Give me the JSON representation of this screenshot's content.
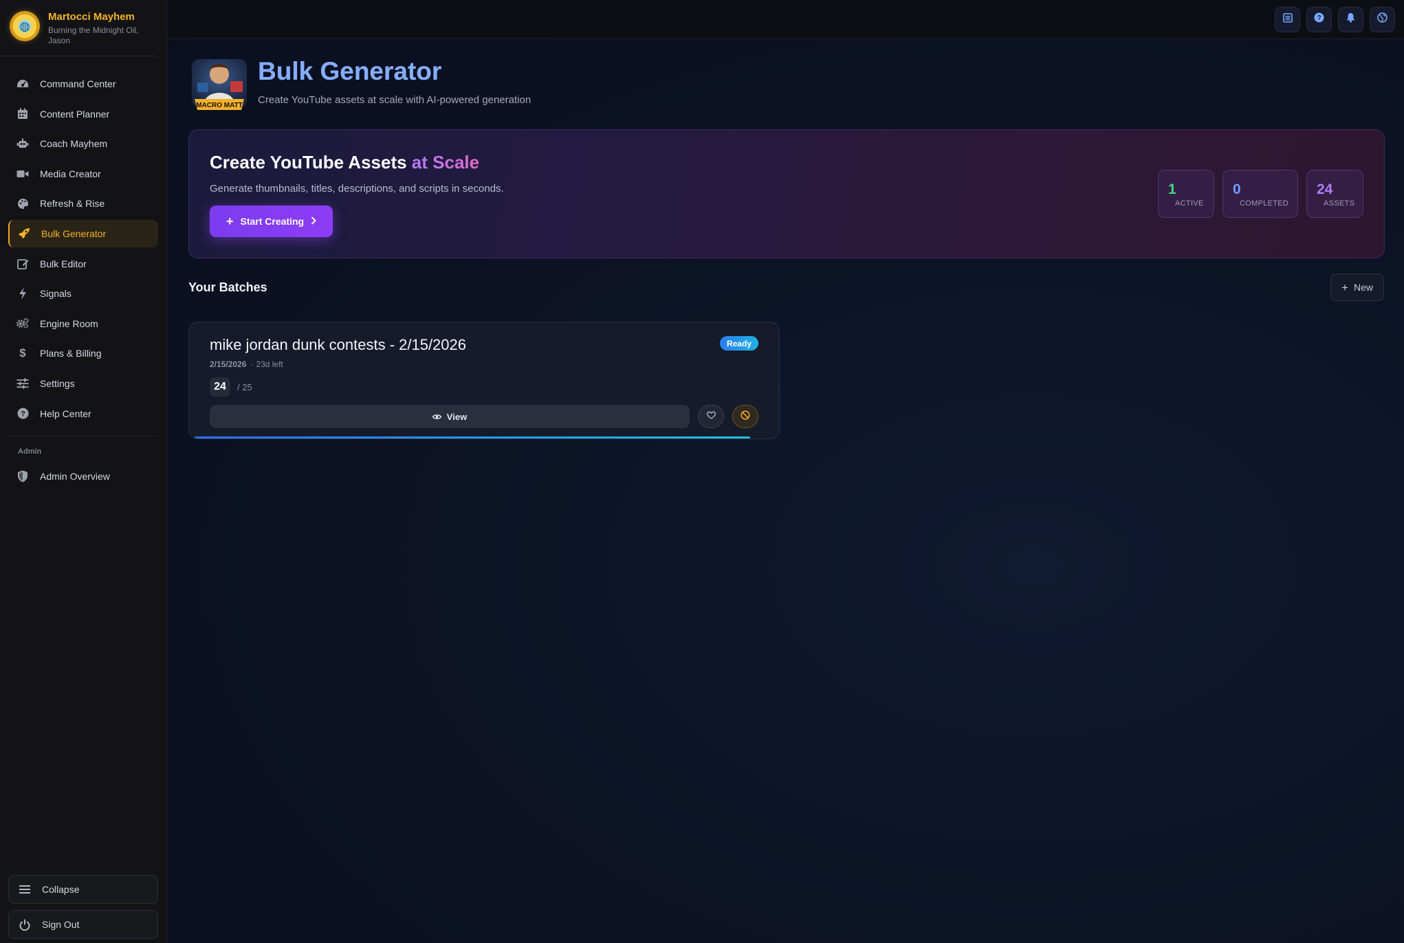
{
  "brand": {
    "name": "Martocci Mayhem",
    "subtitle": "Burning the Midnight Oil, Jason"
  },
  "sidebar": {
    "items": [
      {
        "label": "Command Center",
        "icon": "gauge-icon"
      },
      {
        "label": "Content Planner",
        "icon": "calendar-icon"
      },
      {
        "label": "Coach Mayhem",
        "icon": "robot-icon"
      },
      {
        "label": "Media Creator",
        "icon": "video-icon"
      },
      {
        "label": "Refresh & Rise",
        "icon": "palette-icon"
      },
      {
        "label": "Bulk Generator",
        "icon": "rocket-icon",
        "active": true
      },
      {
        "label": "Bulk Editor",
        "icon": "edit-icon"
      },
      {
        "label": "Signals",
        "icon": "bolt-icon"
      },
      {
        "label": "Engine Room",
        "icon": "gears-icon"
      },
      {
        "label": "Plans & Billing",
        "icon": "dollar-icon"
      },
      {
        "label": "Settings",
        "icon": "sliders-icon"
      },
      {
        "label": "Help Center",
        "icon": "question-icon"
      }
    ],
    "admin_label": "Admin",
    "admin_items": [
      {
        "label": "Admin Overview",
        "icon": "shield-icon"
      }
    ],
    "collapse_label": "Collapse",
    "signout_label": "Sign Out"
  },
  "topbar": {
    "buttons": [
      "list-icon",
      "help-icon",
      "bell-icon",
      "globe-icon"
    ]
  },
  "page": {
    "title": "Bulk Generator",
    "subtitle": "Create YouTube assets at scale with AI-powered generation",
    "mascot_text": "MACRO MATT"
  },
  "hero": {
    "title_main": "Create YouTube Assets ",
    "title_accent": "at Scale",
    "subtitle": "Generate thumbnails, titles, descriptions, and scripts in seconds.",
    "cta_label": "Start Creating",
    "stats": [
      {
        "value": "1",
        "label": "ACTIVE",
        "color": "#3ddc84"
      },
      {
        "value": "0",
        "label": "COMPLETED",
        "color": "#6f9cff"
      },
      {
        "value": "24",
        "label": "ASSETS",
        "color": "#b07cff"
      }
    ]
  },
  "batches": {
    "title": "Your Batches",
    "new_label": "New",
    "items": [
      {
        "name": "mike jordan dunk contests - 2/15/2026",
        "date": "2/15/2026",
        "remaining": "· 23d left",
        "status": "Ready",
        "count": "24",
        "total": "/ 25",
        "progress": 0.96,
        "view_label": "View"
      }
    ]
  },
  "colors": {
    "accent_gold": "#f5b32a",
    "accent_purple": "#8e3cf5",
    "accent_blue": "#86adff"
  }
}
